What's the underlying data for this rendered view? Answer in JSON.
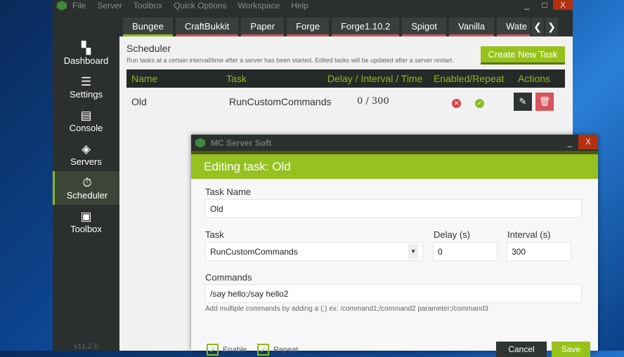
{
  "menu": [
    "File",
    "Server",
    "Toolbox",
    "Quick Options",
    "Workspace",
    "Help"
  ],
  "window_buttons": {
    "minimize": "_",
    "maximize": "□",
    "close": "X"
  },
  "sidebar": [
    {
      "label": "Dashboard",
      "icon": "dashboard-icon"
    },
    {
      "label": "Settings",
      "icon": "sliders-icon"
    },
    {
      "label": "Console",
      "icon": "console-icon"
    },
    {
      "label": "Servers",
      "icon": "layers-icon"
    },
    {
      "label": "Scheduler",
      "icon": "stopwatch-icon",
      "active": true
    },
    {
      "label": "Toolbox",
      "icon": "toolbox-icon"
    }
  ],
  "version": "v11.2.0",
  "tabs": [
    "Bungee",
    "CraftBukkit",
    "Paper",
    "Forge",
    "Forge1.10.2",
    "Spigot",
    "Vanilla",
    "Wate"
  ],
  "tab_arrows": {
    "prev": "❮",
    "next": "❯"
  },
  "scheduler": {
    "title": "Scheduler",
    "description": "Run tasks at a certain interval/time after a server has been started. Edited tasks will be updated after a server restart.",
    "create_button": "Create New Task",
    "columns": [
      "Name",
      "Task",
      "Delay / Interval / Time",
      "Enabled/Repeat",
      "Actions"
    ],
    "rows": [
      {
        "name": "Old",
        "task": "RunCustomCommands",
        "timing": "0 / 300",
        "enabled": false,
        "repeat": true
      }
    ]
  },
  "dialog": {
    "app_title": "MC Server Soft",
    "heading": "Editing task: Old",
    "task_name_label": "Task Name",
    "task_name": "Old",
    "task_label": "Task",
    "task_value": "RunCustomCommands",
    "delay_label": "Delay (s)",
    "delay": "0",
    "interval_label": "Interval (s)",
    "interval": "300",
    "commands_label": "Commands",
    "commands": "/say hello;/say hello2",
    "hint": "Add multiple commands by adding a (;) ex: /command1;/command2 parameter;/command3",
    "enable_label": "Enable",
    "repeat_label": "Repeat",
    "cancel": "Cancel",
    "save": "Save"
  },
  "colors": {
    "accent": "#96c11f",
    "danger": "#c8575a",
    "dark": "#2b2f2e"
  }
}
